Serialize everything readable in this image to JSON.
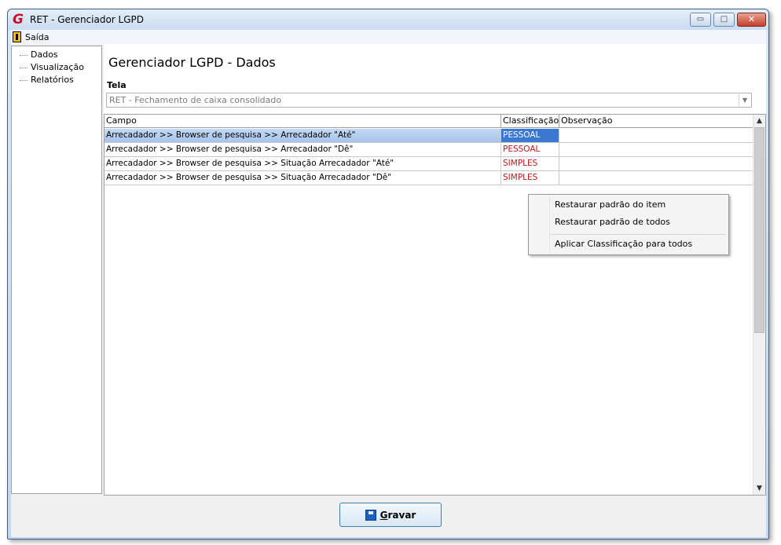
{
  "window": {
    "title": "RET - Gerenciador LGPD",
    "app_icon": "G",
    "controls": {
      "minimize": "▭",
      "maximize": "□",
      "close": "✕"
    }
  },
  "menubar": {
    "exit_label": "Saída"
  },
  "sidebar": {
    "items": [
      {
        "label": "Dados"
      },
      {
        "label": "Visualização"
      },
      {
        "label": "Relatórios"
      }
    ]
  },
  "main": {
    "heading": "Gerenciador LGPD - Dados",
    "screen_label": "Tela",
    "screen_value": "RET - Fechamento de caixa consolidado",
    "grid": {
      "columns": [
        "Campo",
        "Classificação",
        "Observação"
      ],
      "rows": [
        {
          "campo": "Arrecadador >> Browser de pesquisa >> Arrecadador \"Até\"",
          "classificacao": "PESSOAL",
          "observacao": "",
          "selected": true
        },
        {
          "campo": "Arrecadador >> Browser de pesquisa >> Arrecadador \"Dê\"",
          "classificacao": "PESSOAL",
          "observacao": "",
          "selected": false
        },
        {
          "campo": "Arrecadador >> Browser de pesquisa >> Situação Arrecadador \"Até\"",
          "classificacao": "SIMPLES",
          "observacao": "",
          "selected": false
        },
        {
          "campo": "Arrecadador >> Browser de pesquisa >> Situação Arrecadador \"Dê\"",
          "classificacao": "SIMPLES",
          "observacao": "",
          "selected": false
        }
      ]
    },
    "context_menu": {
      "items": [
        "Restaurar padrão do item",
        "Restaurar padrão de todos",
        "Aplicar Classificação para todos"
      ]
    }
  },
  "footer": {
    "save_label_first": "G",
    "save_label_rest": "ravar"
  },
  "colors": {
    "classification": "#c2171c",
    "selection": "#3b78d1",
    "title_icon": "#c8102e"
  }
}
